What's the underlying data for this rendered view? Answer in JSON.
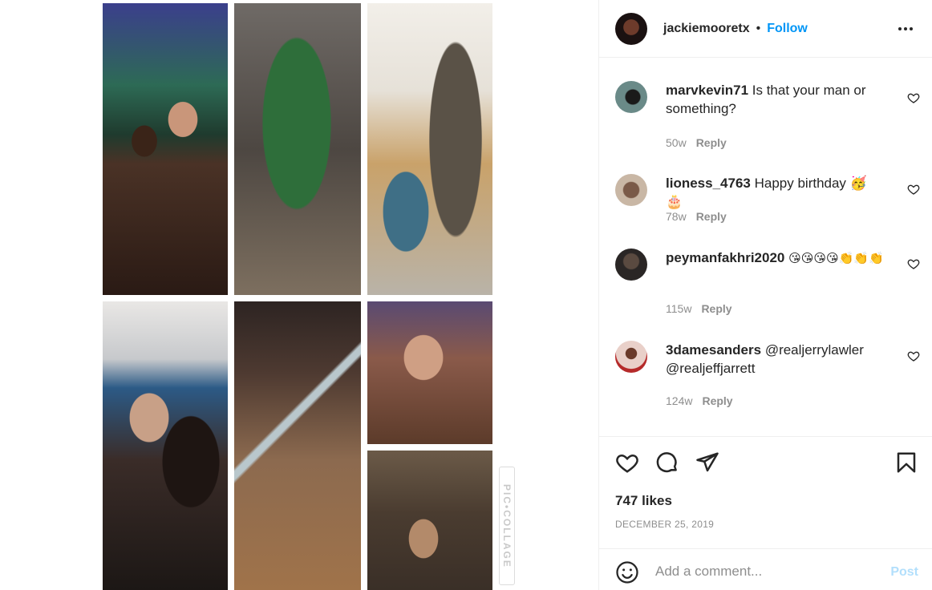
{
  "post": {
    "author": "jackiemooretx",
    "separator": "•",
    "follow_label": "Follow",
    "watermark": "PIC•COLLAGE",
    "photos": [
      {
        "name": "couple-christmas-tree-photo"
      },
      {
        "name": "couple-blue-christmas-tree-photo"
      },
      {
        "name": "woman-cowboy-statue-photo"
      },
      {
        "name": "couple-selfie-restaurant-photo"
      },
      {
        "name": "store-wooden-frame-photo"
      },
      {
        "name": "man-smiling-selfie-photo"
      },
      {
        "name": "couple-antique-store-photo"
      }
    ]
  },
  "comments": [
    {
      "user": "marvkevin71",
      "text": "Is that your man or something?",
      "age": "50w",
      "reply_label": "Reply"
    },
    {
      "user": "lioness_4763",
      "text": "Happy birthday 🥳 🎂",
      "age": "78w",
      "reply_label": "Reply"
    },
    {
      "user": "peymanfakhri2020",
      "text": "😘😘😘😘👏👏👏",
      "age": "115w",
      "reply_label": "Reply"
    },
    {
      "user": "3damesanders",
      "text": "@realjerrylawler @realjeffjarrett",
      "age": "124w",
      "reply_label": "Reply"
    }
  ],
  "stats": {
    "likes": "747 likes",
    "date": "DECEMBER 25, 2019"
  },
  "composer": {
    "placeholder": "Add a comment...",
    "post_label": "Post"
  },
  "colors": {
    "accent": "#0095f6",
    "post_disabled": "#b2dffc",
    "secondary_text": "#8e8e8e"
  }
}
